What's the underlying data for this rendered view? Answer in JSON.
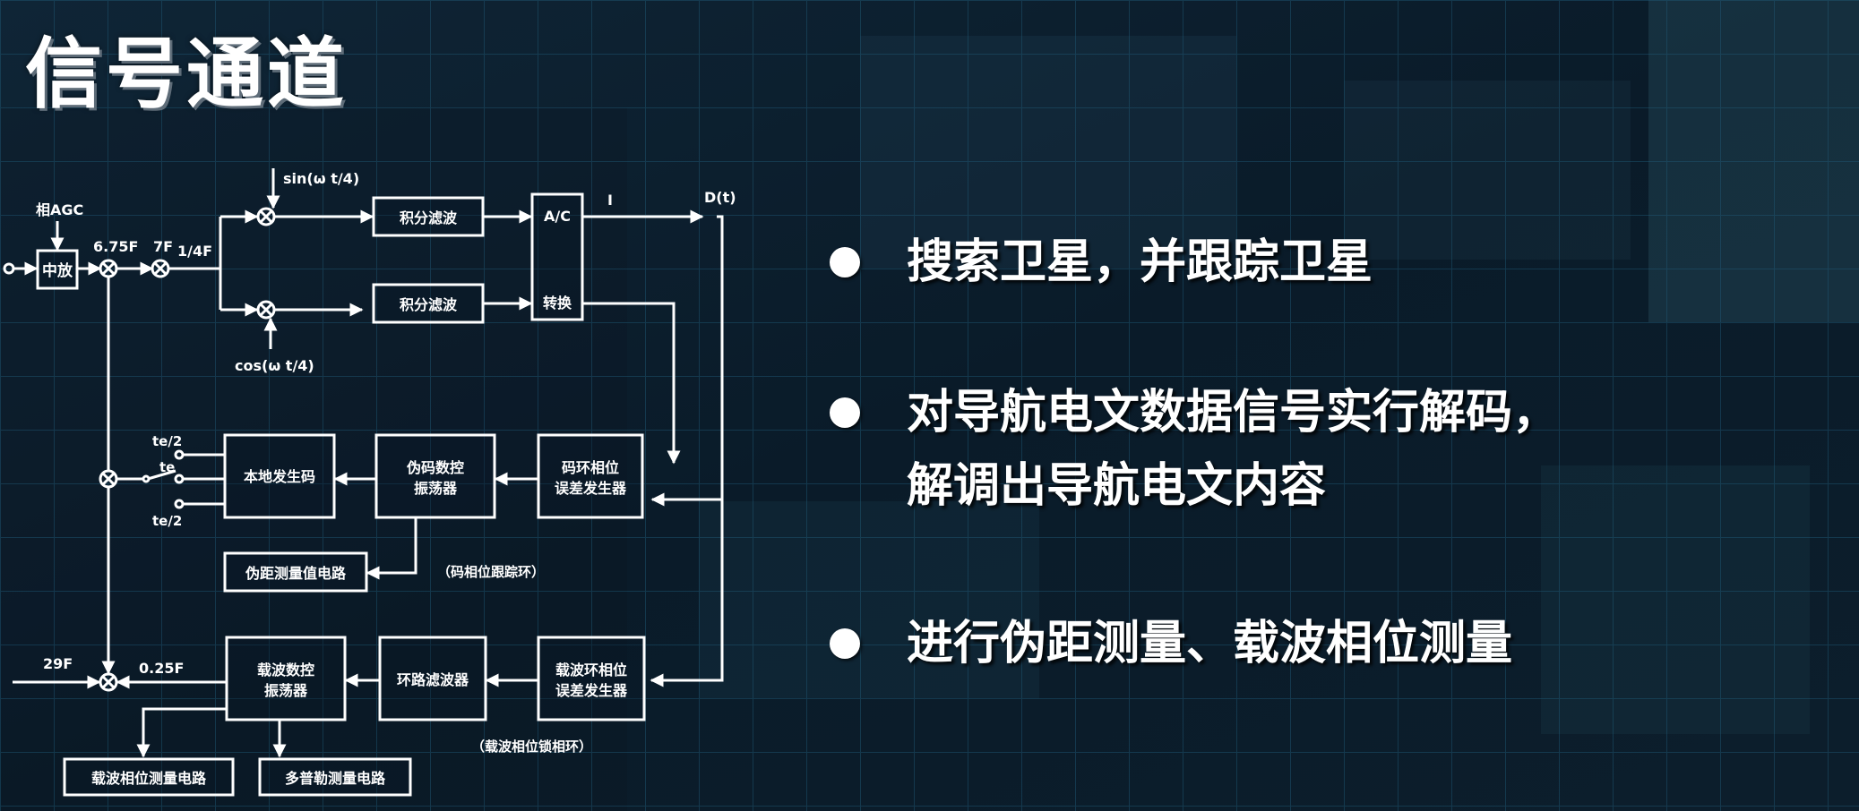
{
  "slide": {
    "title": "信号通道",
    "bullets": [
      {
        "lines": [
          "搜索卫星，并跟踪卫星"
        ]
      },
      {
        "lines": [
          "对导航电文数据信号实行解码，",
          "解调出导航电文内容"
        ]
      },
      {
        "lines": [
          "进行伪距测量、载波相位测量"
        ]
      }
    ]
  },
  "diagram": {
    "signals": {
      "agc": "相AGC",
      "f675": "6.75F",
      "f7": "7F",
      "f14": "1/4F",
      "sin": "sin(ω t/4)",
      "cos": "cos(ω t/4)",
      "i": "I",
      "dt": "D(t)",
      "f29": "29F",
      "f025": "0.25F",
      "te2_top": "te/2",
      "te": "te",
      "te2_bot": "te/2"
    },
    "blocks": {
      "if_amp": "中放",
      "int_filter_1": "积分滤波",
      "int_filter_2": "积分滤波",
      "ad_top": "A/C",
      "ad_bottom": "转换",
      "local_code": "本地发生码",
      "code_nco_1": "伪码数控",
      "code_nco_2": "振荡器",
      "code_err_1": "码环相位",
      "code_err_2": "误差发生器",
      "pseudorange": "伪距测量值电路",
      "carrier_nco_1": "载波数控",
      "carrier_nco_2": "振荡器",
      "loop_filter": "环路滤波器",
      "carrier_err_1": "载波环相位",
      "carrier_err_2": "误差发生器",
      "carrier_phase_meas": "载波相位测量电路",
      "doppler_meas": "多普勒测量电路"
    },
    "loops": {
      "code_loop": "（码相位跟踪环）",
      "carrier_loop": "（载波相位锁相环）"
    }
  }
}
